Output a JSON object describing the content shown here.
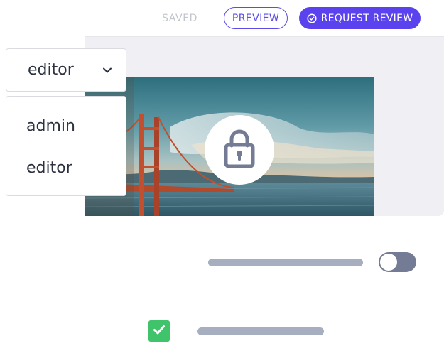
{
  "toolbar": {
    "saved_label": "SAVED",
    "preview_label": "PREVIEW",
    "request_review_label": "REQUEST REVIEW",
    "request_review_icon": "check-circle-icon"
  },
  "role_dropdown": {
    "selected": "editor",
    "options": [
      "admin",
      "editor"
    ],
    "icon": "chevron-down-icon"
  },
  "media": {
    "image_subject": "Golden Gate Bridge at sunset",
    "overlay_icon": "lock-icon"
  },
  "toggle": {
    "state": "off"
  },
  "checkbox": {
    "checked": true
  },
  "colors": {
    "accent": "#5a43ee",
    "saved_text": "#c3c6cc",
    "panel_bg": "#f0f0f4",
    "placeholder_bar": "#a7aebf",
    "toggle_track": "#737b95",
    "checkbox_green": "#3fc46b"
  }
}
